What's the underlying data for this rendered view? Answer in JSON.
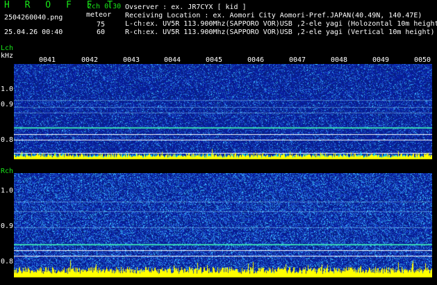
{
  "header": {
    "logo": "H R O F F T",
    "version": "2ch 0.30",
    "filename": "2504260040.png",
    "datetime": "25.04.26 00:40",
    "mode_label": "meteor",
    "l_value": "75",
    "r_value": "60",
    "observer": "Ovserver           : ex. JR7CYX [ kid ]",
    "location": "Receiving Location : ex. Aomori City Aomori-Pref.JAPAN(40.49N, 140.47E)",
    "lch_info": "L-ch:ex. UV5R 113.900Mhz(SAPPORO VOR)USB ,2-ele yagi (Holozontal 10m height)",
    "rch_info": "R-ch:ex. UV5R 113.900Mhz(SAPPORO VOR)USB ,2-ele yagi (Vertical 10m height)"
  },
  "lch": {
    "channel_label": "Lch",
    "unit_label": "kHz",
    "y_ticks": [
      "1.0",
      "0.9",
      "0.8"
    ],
    "time_labels": [
      "0041",
      "0042",
      "0043",
      "0044",
      "0045",
      "0046",
      "0047",
      "0048",
      "0049",
      "0050"
    ]
  },
  "rch": {
    "channel_label": "Rch",
    "y_ticks": [
      "1.0",
      "0.9",
      "0.8"
    ]
  },
  "colors": {
    "label_green": "#19e619",
    "background_blue": "#0a1a8c",
    "noise_cyan": "#00e0ff",
    "noise_yellow": "#ffff00"
  }
}
